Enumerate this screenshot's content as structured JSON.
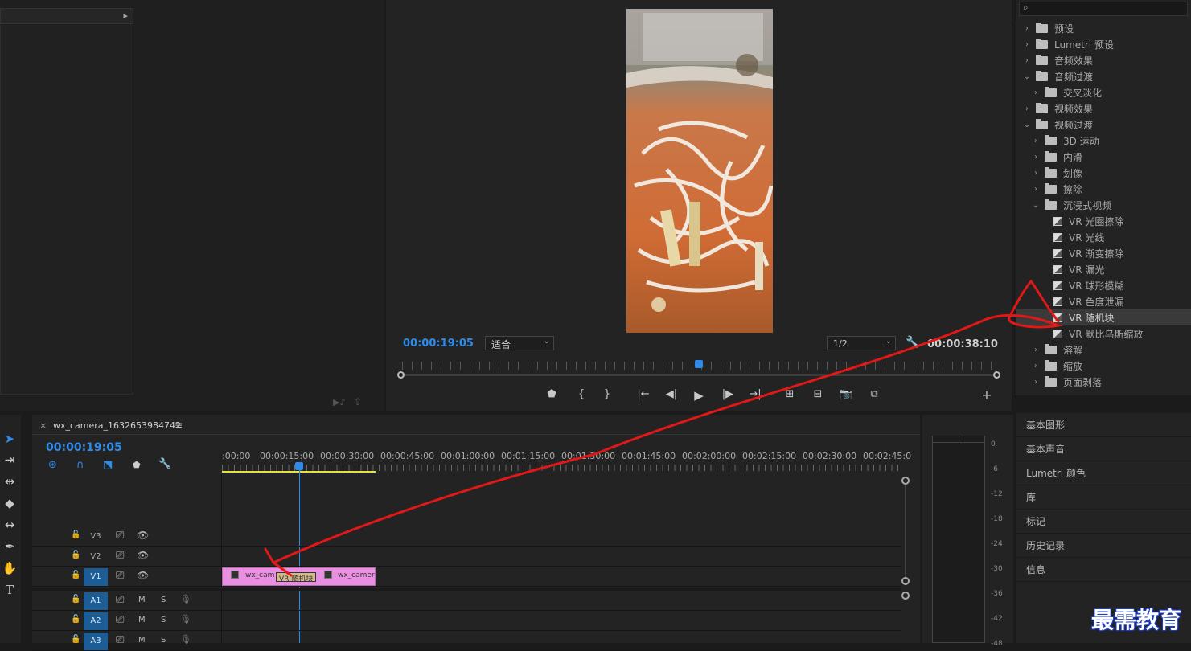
{
  "source_monitor": {
    "arrow": "▸"
  },
  "program_monitor": {
    "timecode": "00:00:19:05",
    "fit_label": "适合",
    "resolution": "1/2",
    "duration": "00:00:38:10",
    "playhead_fraction": 0.5
  },
  "effects": {
    "search_placeholder": "",
    "items": [
      {
        "label": "预设",
        "type": "preset-folder",
        "chev": "›",
        "indent": 0
      },
      {
        "label": "Lumetri 预设",
        "type": "preset-folder",
        "chev": "›",
        "indent": 0
      },
      {
        "label": "音频效果",
        "type": "folder",
        "chev": "›",
        "indent": 0
      },
      {
        "label": "音频过渡",
        "type": "folder",
        "chev": "⌄",
        "indent": 0
      },
      {
        "label": "交叉淡化",
        "type": "folder",
        "chev": "›",
        "indent": 1
      },
      {
        "label": "视频效果",
        "type": "folder",
        "chev": "›",
        "indent": 0
      },
      {
        "label": "视频过渡",
        "type": "folder",
        "chev": "⌄",
        "indent": 0
      },
      {
        "label": "3D 运动",
        "type": "folder",
        "chev": "›",
        "indent": 1
      },
      {
        "label": "内滑",
        "type": "folder",
        "chev": "›",
        "indent": 1
      },
      {
        "label": "划像",
        "type": "folder",
        "chev": "›",
        "indent": 1
      },
      {
        "label": "擦除",
        "type": "folder",
        "chev": "›",
        "indent": 1
      },
      {
        "label": "沉浸式视频",
        "type": "folder",
        "chev": "⌄",
        "indent": 1
      },
      {
        "label": "VR 光圈擦除",
        "type": "fx",
        "chev": "",
        "indent": 2
      },
      {
        "label": "VR 光线",
        "type": "fx",
        "chev": "",
        "indent": 2
      },
      {
        "label": "VR 渐变擦除",
        "type": "fx",
        "chev": "",
        "indent": 2
      },
      {
        "label": "VR 漏光",
        "type": "fx",
        "chev": "",
        "indent": 2
      },
      {
        "label": "VR 球形模糊",
        "type": "fx",
        "chev": "",
        "indent": 2
      },
      {
        "label": "VR 色度泄漏",
        "type": "fx",
        "chev": "",
        "indent": 2
      },
      {
        "label": "VR 随机块",
        "type": "fx",
        "chev": "",
        "indent": 2,
        "selected": true
      },
      {
        "label": "VR 默比乌斯缩放",
        "type": "fx",
        "chev": "",
        "indent": 2
      },
      {
        "label": "溶解",
        "type": "folder",
        "chev": "›",
        "indent": 1
      },
      {
        "label": "缩放",
        "type": "folder",
        "chev": "›",
        "indent": 1
      },
      {
        "label": "页面剥落",
        "type": "folder",
        "chev": "›",
        "indent": 1
      }
    ]
  },
  "side_panels": [
    "基本图形",
    "基本声音",
    "Lumetri 颜色",
    "库",
    "标记",
    "历史记录",
    "信息"
  ],
  "timeline": {
    "tab_close": "×",
    "sequence_name": "wx_camera_1632653984742",
    "menu_icon": "≡",
    "timecode": "00:00:19:05",
    "ruler_labels": [
      ":00:00",
      "00:00:15:00",
      "00:00:30:00",
      "00:00:45:00",
      "00:01:00:00",
      "00:01:15:00",
      "00:01:30:00",
      "00:01:45:00",
      "00:02:00:00",
      "00:02:15:00",
      "00:02:30:00",
      "00:02:45:0"
    ],
    "tracks": [
      {
        "name": "V3",
        "m": "",
        "s": "",
        "targeted": false
      },
      {
        "name": "V2",
        "m": "",
        "s": "",
        "targeted": false
      },
      {
        "name": "V1",
        "m": "",
        "s": "",
        "targeted": true
      },
      {
        "name": "A1",
        "m": "M",
        "s": "S",
        "targeted": true
      },
      {
        "name": "A2",
        "m": "M",
        "s": "S",
        "targeted": true
      },
      {
        "name": "A3",
        "m": "M",
        "s": "S",
        "targeted": true
      }
    ],
    "clip_a_label": "wx_cam",
    "transition_label": "VR 随机块",
    "clip_b_label": "wx_camer"
  },
  "meter": {
    "labels": [
      "0",
      "-6",
      "-12",
      "-18",
      "-24",
      "-30",
      "-36",
      "-42",
      "-48"
    ]
  },
  "watermark": "最需教育",
  "colors": {
    "accent": "#2d8ceb",
    "clip": "#e98ee0",
    "annotation": "#e01818"
  }
}
